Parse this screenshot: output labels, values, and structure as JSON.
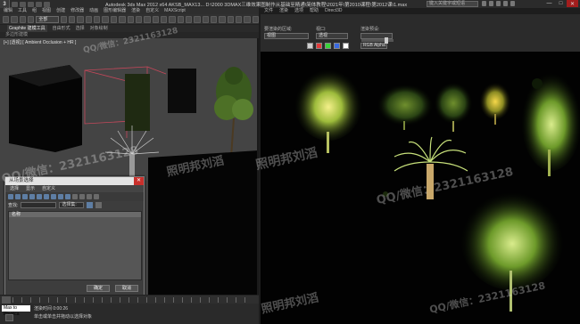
{
  "window": {
    "logo": "3",
    "title": "Autodesk 3ds Max  2012 x64    AKSB_MAX13...  D:\\2000 3DMAX三维效果图制作从基础至精通\\简体教程\\2021年\\第2010课程\\第2012课\\1.max",
    "search_placeholder": "键入关键字或短语",
    "minimize": "—",
    "maximize": "□",
    "close": "✕"
  },
  "menubar_left": [
    "编辑",
    "工具",
    "组",
    "视图",
    "创建",
    "修改器",
    "动画",
    "图形编辑器",
    "渲染",
    "自定义",
    "MAXScript"
  ],
  "menubar_right": [
    "文件",
    "渲染",
    "选项",
    "帮助",
    "Direct3D"
  ],
  "toolbar": {
    "selection_filter": "全部"
  },
  "ribbon": {
    "tabs": [
      "Graphite 建模工具",
      "自由形式",
      "选择",
      "对象绘制"
    ],
    "active_tab": "Graphite 建模工具",
    "sub": "多边形建模"
  },
  "viewport_left": {
    "label": "[+] [透视] [ Ambient Occlusion + HR ]"
  },
  "render_header": {
    "area_label": "要渲染的区域:",
    "area_value": "视图",
    "viewport_label": "视口:",
    "viewport_value": "透视",
    "preset_label": "渲染预设:",
    "preset_value": "",
    "channel_value": "RGB Alpha",
    "render_button": "渲染"
  },
  "scene_explorer": {
    "title": "从场景选择",
    "close": "✕",
    "menu": [
      "选择",
      "显示",
      "自定义"
    ],
    "search_label": "查找:",
    "search_value": "",
    "filter_value": "选择集:",
    "column_header": "名称",
    "ok": "确定",
    "cancel": "取消"
  },
  "statusbar": {
    "mode": "Max to Physica",
    "message1": "渲染时间 0:00:26",
    "message2": "单击或单击并拖动以选择对象",
    "frame": "0 / 100"
  },
  "watermarks": [
    "QQ/微信：2321163128",
    "照明邦刘滔",
    "QQ/微信：2321163128",
    "照明邦刘滔",
    "QQ/微信：2321163128",
    "照明邦刘滔",
    "QQ/微信：2321163128"
  ],
  "colors": {
    "viewport_grey": "#444444",
    "render_black": "#020202",
    "tree_light": "#b6d65a",
    "close_red": "#c9302c"
  }
}
